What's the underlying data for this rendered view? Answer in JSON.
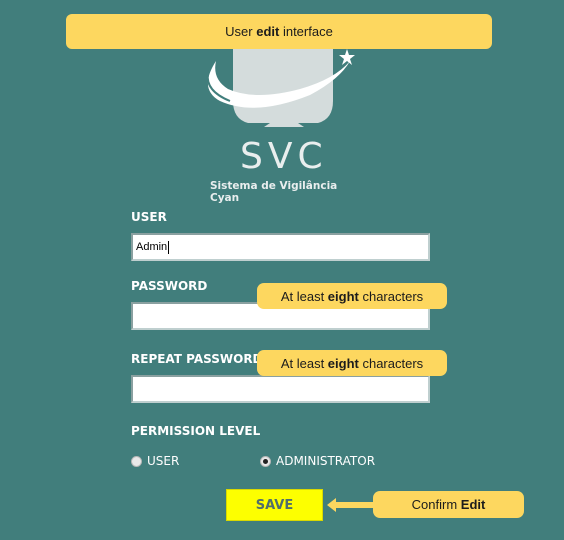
{
  "callouts": {
    "top": {
      "before": "User ",
      "bold": "edit",
      "after": " interface"
    },
    "password": {
      "before": "At least ",
      "bold": "eight",
      "after": " characters"
    },
    "repeat_password": {
      "before": "At least ",
      "bold": "eight",
      "after": " characters"
    },
    "save": {
      "before": "Confirm ",
      "bold": "Edit",
      "after": ""
    }
  },
  "brand": {
    "name": "SVC",
    "subtitle": "Sistema de Vigilância Cyan",
    "logo_icon": "monitor-swoosh-icon"
  },
  "form": {
    "user_label": "USER",
    "user_value": "Admin",
    "password_label": "PASSWORD",
    "password_value": "",
    "repeat_label": "REPEAT PASSWORD",
    "repeat_value": "",
    "permission_label": "PERMISSION LEVEL",
    "options": [
      {
        "label": "USER",
        "selected": false
      },
      {
        "label": "ADMINISTRATOR",
        "selected": true
      }
    ],
    "save_label": "SAVE"
  },
  "colors": {
    "background": "#417e7c",
    "callout": "#fdd75f",
    "save_button": "#fdff00"
  }
}
